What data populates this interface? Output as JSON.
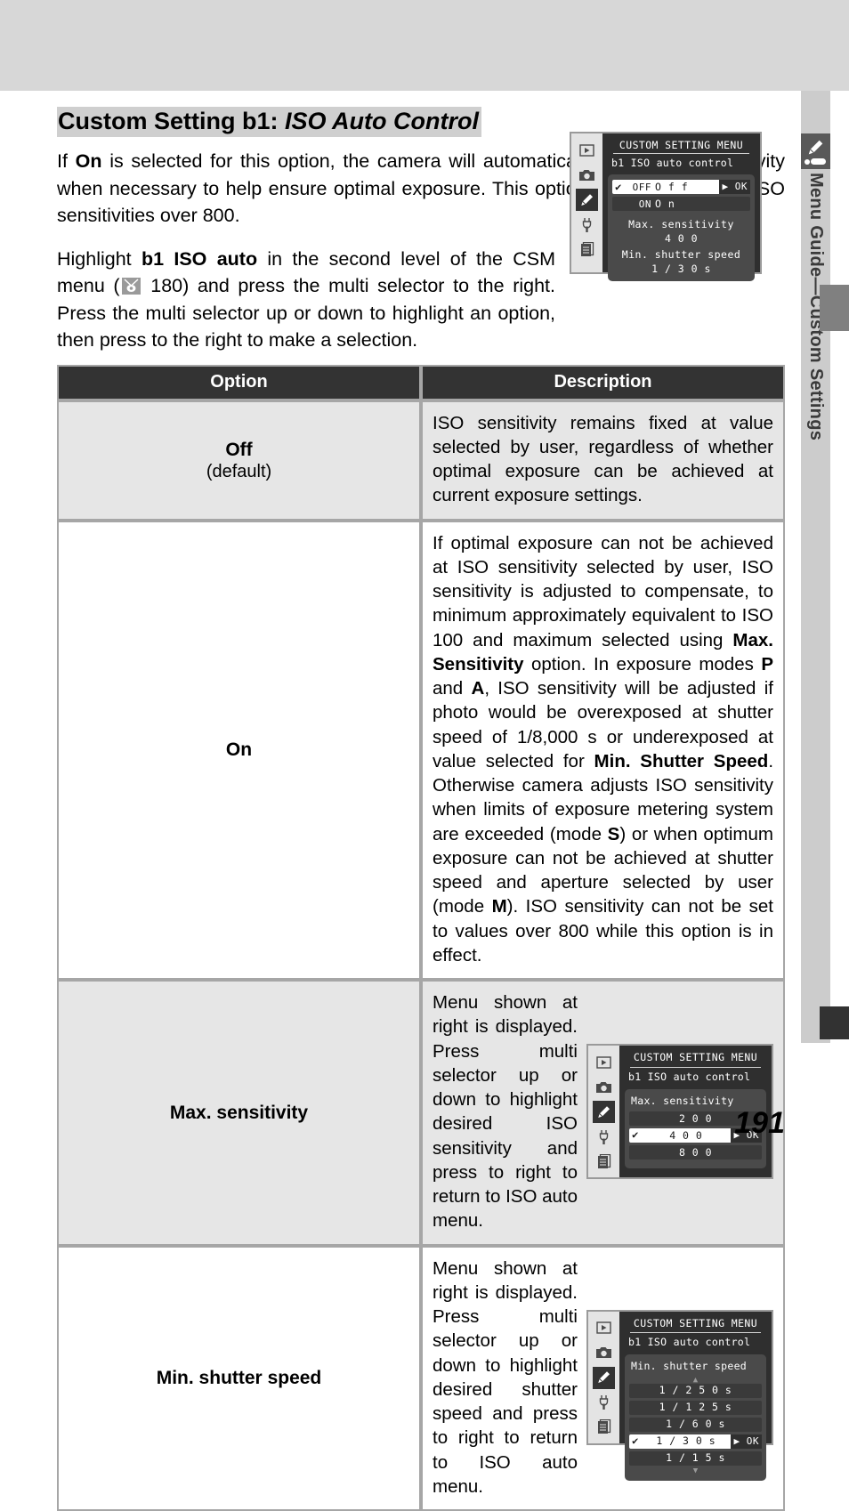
{
  "page": {
    "number": "191",
    "side_tab_label": "Menu Guide—Custom Settings"
  },
  "heading": {
    "prefix": "Custom Setting b1: ",
    "italic": "ISO Auto Control"
  },
  "intro": {
    "p1_a": "If ",
    "p1_bold": "On",
    "p1_b": " is selected for this option, the camera will automatically adjust ISO sensitivity when necessary to help ensure optimal exposure.  This option is not available at ISO sensitivities over 800.",
    "p2_a": "Highlight ",
    "p2_bold": "b1 ISO auto",
    "p2_b": " in the second level of the CSM menu (",
    "p2_page": " 180) and press the multi selector to the right.  Press the multi selector up or down to highlight an option, then press to the right to make a selection."
  },
  "table": {
    "headers": [
      "Option",
      "Description"
    ],
    "rows": [
      {
        "option": "Off",
        "option_note": "(default)",
        "description": "ISO sensitivity remains fixed at value selected by user, regardless of whether optimal exposure can be achieved at current exposure settings."
      },
      {
        "option": "On",
        "desc_1": "If optimal exposure can not be achieved at ISO sensitivity selected by user, ISO sensitivity is adjusted to compensate, to minimum approximately equivalent to ISO 100 and maximum selected using ",
        "desc_bold_1": "Max. Sensitivity",
        "desc_2": " option.  In exposure modes ",
        "desc_bold_2": "P",
        "desc_3": " and ",
        "desc_bold_3": "A",
        "desc_4": ", ISO sensitivity will be adjusted if photo would be overexposed at shutter speed of ",
        "desc_frac": "1/8,000",
        "desc_5": " s or underexposed at value selected for ",
        "desc_bold_4": "Min. Shutter Speed",
        "desc_6": ".  Otherwise camera adjusts ISO sensitivity when limits of exposure metering system are exceeded (mode ",
        "desc_bold_5": "S",
        "desc_7": ") or when optimum exposure can not be achieved at shutter speed and aperture selected by user (mode ",
        "desc_bold_6": "M",
        "desc_8": ").  ISO sensitivity can not be set to values over 800 while this option is in effect."
      },
      {
        "option": "Max. sensitivity",
        "description": "Menu shown at right is displayed.  Press multi selector up or down to highlight desired ISO sensitivity and press to right to return to ISO auto menu."
      },
      {
        "option": "Min. shutter speed",
        "description": "Menu shown at right is displayed.  Press multi selector up or down to highlight desired shutter speed and press to right to return to ISO auto menu."
      }
    ]
  },
  "lcd_main": {
    "title": "CUSTOM SETTING MENU",
    "subtitle": "b1  ISO auto control",
    "rows": [
      {
        "check": "✔",
        "code": "OFF",
        "label": "O f f",
        "ok": "▶ OK",
        "highlighted": true
      },
      {
        "check": "",
        "code": "ON",
        "label": "O n",
        "ok": "",
        "highlighted": false
      }
    ],
    "extra": [
      "Max. sensitivity",
      "4 0 0",
      "Min. shutter speed",
      "1 / 3 0  s"
    ]
  },
  "lcd_max": {
    "title": "CUSTOM SETTING MENU",
    "subtitle": "b1  ISO auto control",
    "panel_head": "Max. sensitivity",
    "rows": [
      {
        "check": "",
        "label": "2 0 0",
        "ok": "",
        "highlighted": false
      },
      {
        "check": "✔",
        "label": "4 0 0",
        "ok": "▶ OK",
        "highlighted": true
      },
      {
        "check": "",
        "label": "8 0 0",
        "ok": "",
        "highlighted": false
      }
    ]
  },
  "lcd_min": {
    "title": "CUSTOM SETTING MENU",
    "subtitle": "b1  ISO auto control",
    "panel_head": "Min. shutter speed",
    "scroll_up": "▲",
    "scroll_down": "▼",
    "rows": [
      {
        "check": "",
        "label": "1 / 2 5 0  s",
        "ok": "",
        "highlighted": false
      },
      {
        "check": "",
        "label": "1 / 1 2 5  s",
        "ok": "",
        "highlighted": false
      },
      {
        "check": "",
        "label": "1 / 6 0  s",
        "ok": "",
        "highlighted": false
      },
      {
        "check": "✔",
        "label": "1 / 3 0  s",
        "ok": "▶ OK",
        "highlighted": true
      },
      {
        "check": "",
        "label": "1 / 1 5  s",
        "ok": "",
        "highlighted": false
      }
    ]
  },
  "icons": {
    "rail": [
      "playback-icon",
      "camera-icon",
      "pencil-icon",
      "wrench-icon",
      "list-icon"
    ]
  }
}
